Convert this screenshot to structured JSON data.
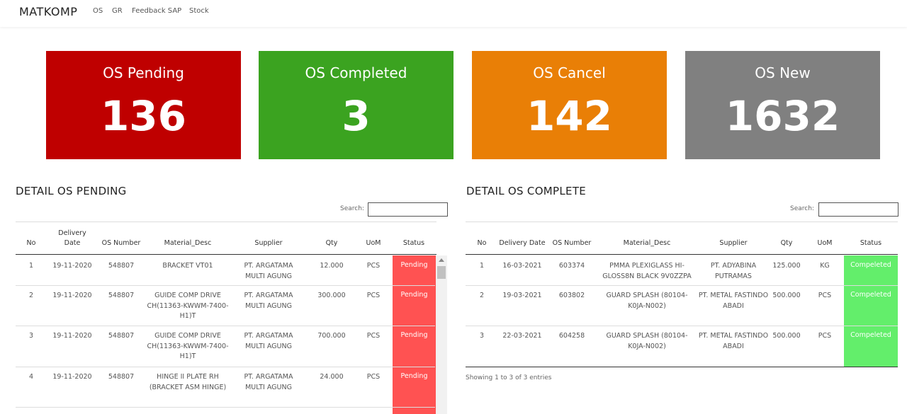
{
  "navbar": {
    "brand": "MATKOMP",
    "links": [
      "OS",
      "GR",
      "Feedback SAP",
      "Stock"
    ]
  },
  "cards": [
    {
      "title": "OS Pending",
      "value": "136",
      "color": "#bf0000"
    },
    {
      "title": "OS Completed",
      "value": "3",
      "color": "#3ba320"
    },
    {
      "title": "OS Cancel",
      "value": "142",
      "color": "#e97f06"
    },
    {
      "title": "OS New",
      "value": "1632",
      "color": "#808080"
    }
  ],
  "pending": {
    "title": "DETAIL OS PENDING",
    "search_label": "Search:",
    "search_value": "",
    "headers": [
      "No",
      "Delivery Date",
      "OS Number",
      "Material_Desc",
      "Supplier",
      "Qty",
      "UoM",
      "Status"
    ],
    "status_color": "#ff5252",
    "rows": [
      {
        "no": "1",
        "date": "19-11-2020",
        "os": "548807",
        "desc": "BRACKET VT01",
        "supplier": "PT. ARGATAMA MULTI AGUNG",
        "qty": "12.000",
        "uom": "PCS",
        "status": "Pending"
      },
      {
        "no": "2",
        "date": "19-11-2020",
        "os": "548807",
        "desc": "GUIDE COMP DRIVE CH(11363-KWWM-7400-H1)T",
        "supplier": "PT. ARGATAMA MULTI AGUNG",
        "qty": "300.000",
        "uom": "PCS",
        "status": "Pending"
      },
      {
        "no": "3",
        "date": "19-11-2020",
        "os": "548807",
        "desc": "GUIDE COMP DRIVE CH(11363-KWWM-7400-H1)T",
        "supplier": "PT. ARGATAMA MULTI AGUNG",
        "qty": "700.000",
        "uom": "PCS",
        "status": "Pending"
      },
      {
        "no": "4",
        "date": "19-11-2020",
        "os": "548807",
        "desc": "HINGE II PLATE RH (BRACKET ASM HINGE)",
        "supplier": "PT. ARGATAMA MULTI AGUNG",
        "qty": "24.000",
        "uom": "PCS",
        "status": "Pending"
      }
    ]
  },
  "complete": {
    "title": "DETAIL OS COMPLETE",
    "search_label": "Search:",
    "search_value": "",
    "headers": [
      "No",
      "Delivery Date",
      "OS Number",
      "Material_Desc",
      "Supplier",
      "Qty",
      "UoM",
      "Status"
    ],
    "status_color": "#63ee6b",
    "rows": [
      {
        "no": "1",
        "date": "16-03-2021",
        "os": "603374",
        "desc": "PMMA PLEXIGLASS HI-GLOSS8N BLACK 9V0ZZPA",
        "supplier": "PT. ADYABINA PUTRAMAS",
        "qty": "125.000",
        "uom": "KG",
        "status": "Compeleted"
      },
      {
        "no": "2",
        "date": "19-03-2021",
        "os": "603802",
        "desc": "GUARD SPLASH (80104-K0JA-N002)",
        "supplier": "PT. METAL FASTINDO ABADI",
        "qty": "500.000",
        "uom": "PCS",
        "status": "Compeleted"
      },
      {
        "no": "3",
        "date": "22-03-2021",
        "os": "604258",
        "desc": "GUARD SPLASH (80104-K0JA-N002)",
        "supplier": "PT. METAL FASTINDO ABADI",
        "qty": "500.000",
        "uom": "PCS",
        "status": "Compeleted"
      }
    ],
    "info": "Showing 1 to 3 of 3 entries"
  }
}
